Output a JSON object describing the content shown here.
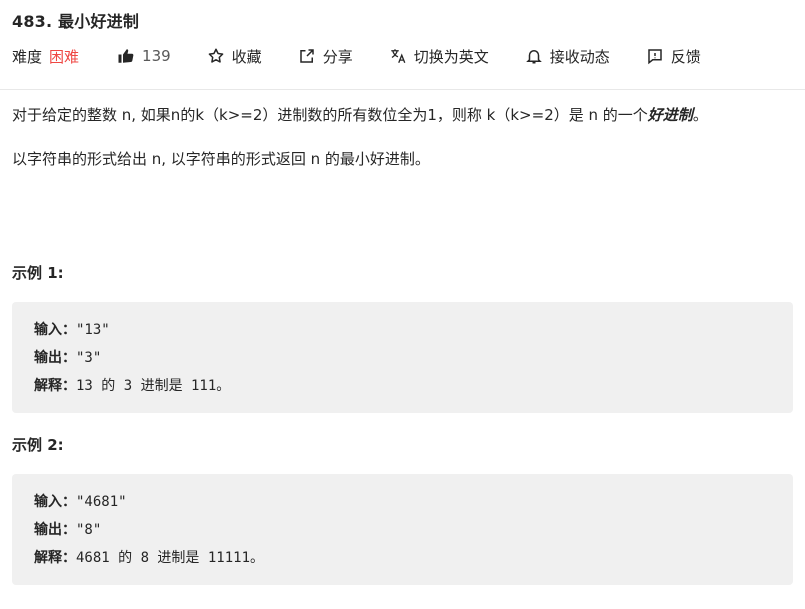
{
  "problem": {
    "title": "483. 最小好进制"
  },
  "meta": {
    "difficulty_label": "难度",
    "difficulty_value": "困难",
    "likes": "139",
    "collect_label": "收藏",
    "share_label": "分享",
    "switch_lang_label": "切换为英文",
    "subscribe_label": "接收动态",
    "feedback_label": "反馈",
    "difficulty_color": "#ef4743"
  },
  "description": {
    "p1_text": "对于给定的整数 n, 如果n的k（k>=2）进制数的所有数位全为1，则称 k（k>=2）是 n 的一个",
    "p1_em": "好进制",
    "p1_end": "。",
    "p2_text": "以字符串的形式给出 n, 以字符串的形式返回 n 的最小好进制。"
  },
  "examples": [
    {
      "title": "示例 1:",
      "input_label": "输入：",
      "input_value": "\"13\"",
      "output_label": "输出：",
      "output_value": "\"3\"",
      "explain_label": "解释：",
      "explain_value": "13 的 3 进制是 111。"
    },
    {
      "title": "示例 2:",
      "input_label": "输入：",
      "input_value": "\"4681\"",
      "output_label": "输出：",
      "output_value": "\"8\"",
      "explain_label": "解释：",
      "explain_value": "4681 的 8 进制是 11111。"
    }
  ],
  "icons": {
    "like": "thumbs-up-icon",
    "collect": "star-icon",
    "share": "share-icon",
    "translate": "translate-icon",
    "subscribe": "bell-icon",
    "feedback": "feedback-icon"
  }
}
